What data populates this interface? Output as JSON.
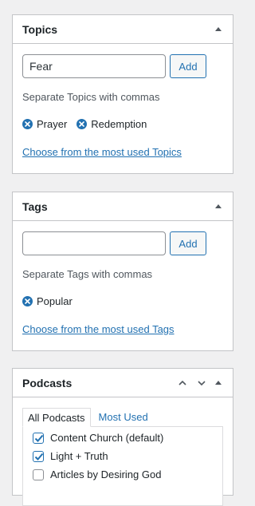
{
  "topics": {
    "title": "Topics",
    "input_value": "Fear",
    "add_label": "Add",
    "howto": "Separate Topics with commas",
    "tags": [
      {
        "label": "Prayer"
      },
      {
        "label": "Redemption"
      }
    ],
    "most_used_link": "Choose from the most used Topics"
  },
  "tags": {
    "title": "Tags",
    "input_value": "",
    "add_label": "Add",
    "howto": "Separate Tags with commas",
    "tags": [
      {
        "label": "Popular"
      }
    ],
    "most_used_link": "Choose from the most used Tags"
  },
  "podcasts": {
    "title": "Podcasts",
    "tabs": [
      {
        "label": "All Podcasts",
        "active": true
      },
      {
        "label": "Most Used",
        "active": false
      }
    ],
    "items": [
      {
        "label": "Content Church (default)",
        "checked": true
      },
      {
        "label": "Light + Truth",
        "checked": true
      },
      {
        "label": "Articles by Desiring God",
        "checked": false
      }
    ]
  },
  "colors": {
    "accent": "#2271b1",
    "border": "#c3c4c7",
    "background": "#f0f0f1"
  }
}
